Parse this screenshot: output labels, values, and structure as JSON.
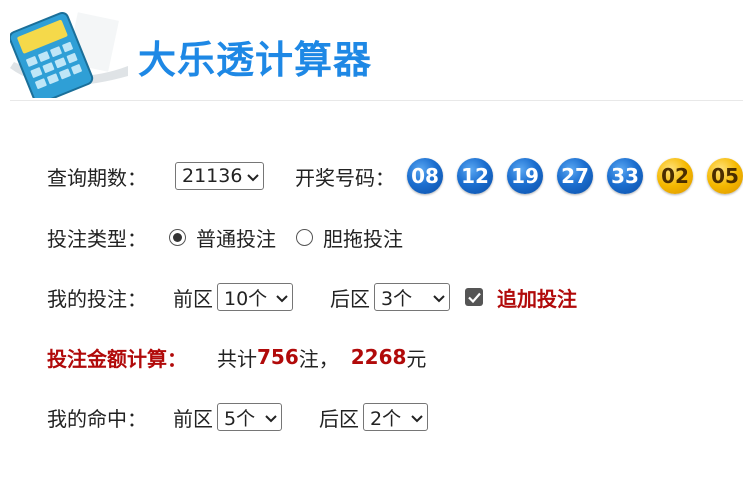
{
  "header": {
    "title": "大乐透计算器",
    "logo_icon": "calculator-icon"
  },
  "query": {
    "period_label": "查询期数：",
    "period_value": "21136",
    "draw_label": "开奖号码：",
    "front_numbers": [
      "08",
      "12",
      "19",
      "27",
      "33"
    ],
    "back_numbers": [
      "02",
      "05"
    ]
  },
  "bet_type": {
    "label": "投注类型：",
    "options": [
      {
        "label": "普通投注",
        "checked": true
      },
      {
        "label": "胆拖投注",
        "checked": false
      }
    ]
  },
  "my_bet": {
    "label": "我的投注：",
    "front_label": "前区",
    "front_value": "10个",
    "back_label": "后区",
    "back_value": "3个",
    "addon_label": "追加投注",
    "addon_checked": true
  },
  "amount": {
    "label": "投注金额计算：",
    "prefix": "共计",
    "count": "756",
    "count_unit": "注，",
    "total": "2268",
    "total_unit": "元"
  },
  "hit": {
    "label": "我的命中：",
    "front_label": "前区",
    "front_value": "5个",
    "back_label": "后区",
    "back_value": "2个"
  },
  "colors": {
    "front_ball": "#1c6fd0",
    "back_ball": "#f5b800",
    "accent_red": "#b10a0a",
    "title_blue": "#1e88e5"
  }
}
